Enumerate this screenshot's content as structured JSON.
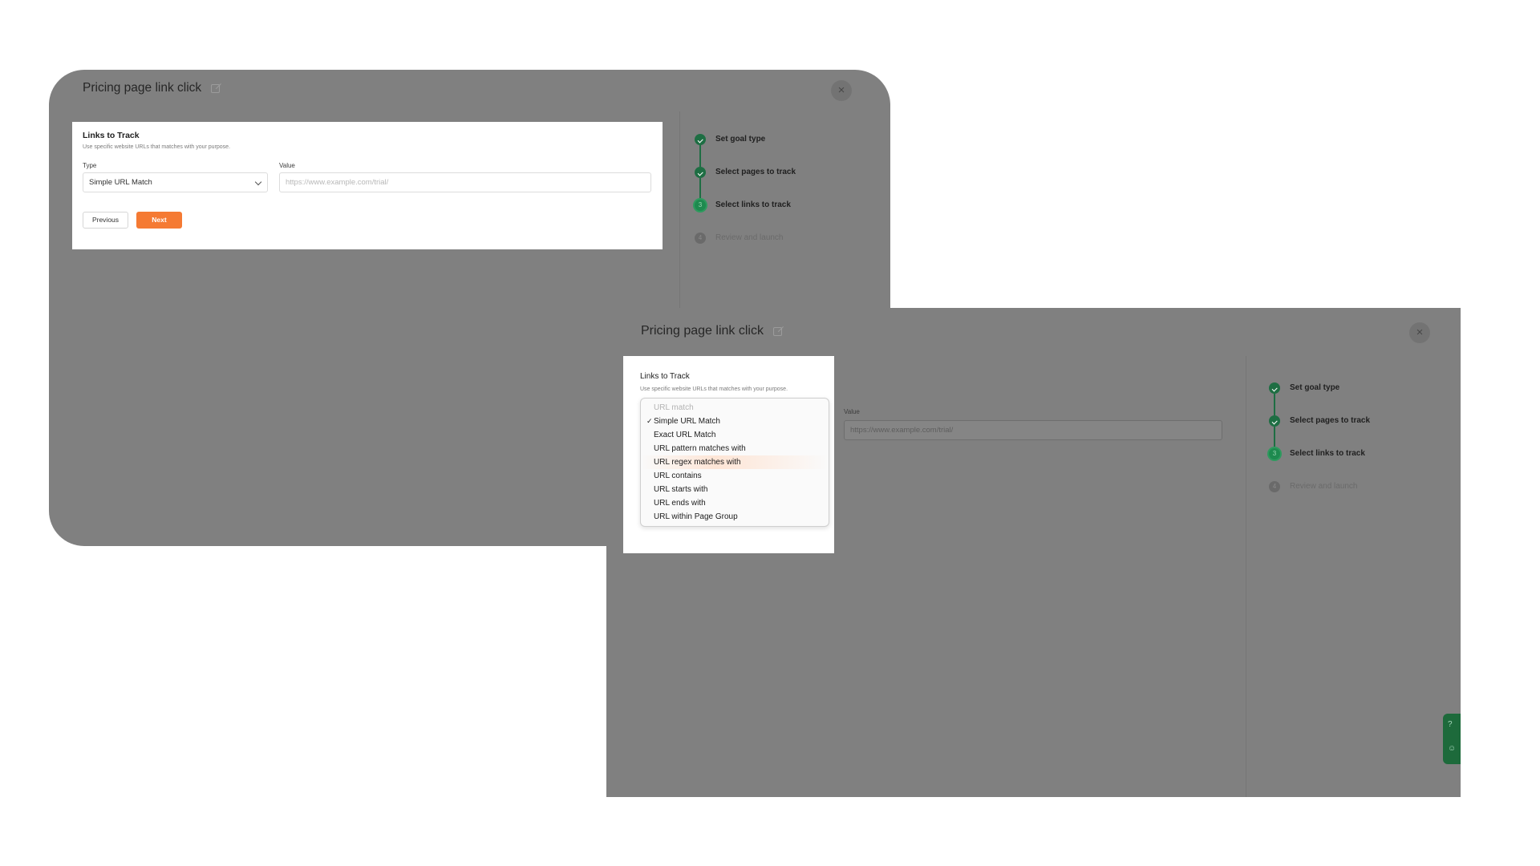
{
  "window_a": {
    "title": "Pricing page link click",
    "close_label": "×",
    "card": {
      "title": "Links to Track",
      "subtitle": "Use specific website URLs that matches with your purpose.",
      "type_label": "Type",
      "type_value": "Simple URL Match",
      "value_label": "Value",
      "value_placeholder": "https://www.example.com/trial/",
      "previous_label": "Previous",
      "next_label": "Next"
    },
    "steps": [
      {
        "label": "Set goal type",
        "status": "done"
      },
      {
        "label": "Select pages to track",
        "status": "done"
      },
      {
        "label": "Select links to track",
        "status": "current",
        "number": "3"
      },
      {
        "label": "Review and launch",
        "status": "pending",
        "number": "4"
      }
    ]
  },
  "window_b": {
    "title": "Pricing page link click",
    "close_label": "×",
    "card": {
      "title": "Links to Track",
      "subtitle": "Use specific website URLs that matches with your purpose."
    },
    "value_label": "Value",
    "value_placeholder": "https://www.example.com/trial/",
    "dropdown": {
      "header": "URL match",
      "selected_mark": "✓",
      "options": [
        "Simple URL Match",
        "Exact URL Match",
        "URL pattern matches with",
        "URL regex matches with",
        "URL contains",
        "URL starts with",
        "URL ends with",
        "URL within Page Group"
      ]
    },
    "steps": [
      {
        "label": "Set goal type",
        "status": "done"
      },
      {
        "label": "Select pages to track",
        "status": "done"
      },
      {
        "label": "Select links to track",
        "status": "current",
        "number": "3"
      },
      {
        "label": "Review and launch",
        "status": "pending",
        "number": "4"
      }
    ],
    "help_widget": {
      "help_glyph": "?",
      "chat_glyph": "☺"
    }
  },
  "colors": {
    "accent_orange": "#f57a33",
    "step_green": "#1e6e43",
    "overlay_gray": "#808080"
  }
}
